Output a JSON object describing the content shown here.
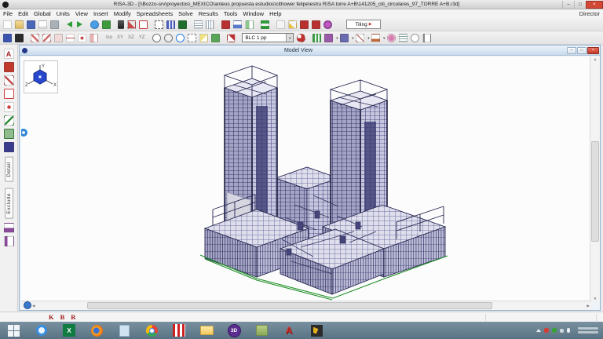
{
  "titlebar": {
    "title": "RISA-3D - [\\\\Bozzo-srv\\proyectos\\_MEXICO\\anteus propuesta estudios\\cithower felipe\\estru RISA torre A+B\\141205_citi_circulares_97_TORRE A+B.r3d]",
    "minimize": "–",
    "maximize": "□",
    "close": "×"
  },
  "menubar": {
    "items": [
      "File",
      "Edit",
      "Global",
      "Units",
      "View",
      "Insert",
      "Modify",
      "Spreadsheets",
      "Solve",
      "Results",
      "Tools",
      "Window",
      "Help"
    ],
    "right_item": "Director"
  },
  "toolbar1": {
    "tiling_label": "Tiling",
    "tiling_arrow": "▶"
  },
  "toolbar2": {
    "views": [
      "Iso",
      "XY",
      "XZ",
      "YZ"
    ],
    "blc_value": "BLC 1 pp",
    "dropdown_arrow": "▼"
  },
  "side_toolbar": {
    "a_label": "A",
    "tab_detail": "Detail",
    "tab_exclude": "Exclude"
  },
  "model_view": {
    "title": "Model View",
    "minimize": "–",
    "restore": "□",
    "close": "×"
  },
  "axis_widget": {
    "x": "X",
    "y": "Y",
    "z": "Z"
  },
  "statusbar": {
    "k": "K",
    "b": "B",
    "r": "R"
  },
  "scroll": {
    "up": "▲",
    "down": "▼",
    "left": "◀",
    "right": "▶"
  },
  "taskbar": {
    "excel": "X",
    "risa": "3D",
    "autocad": "A"
  }
}
